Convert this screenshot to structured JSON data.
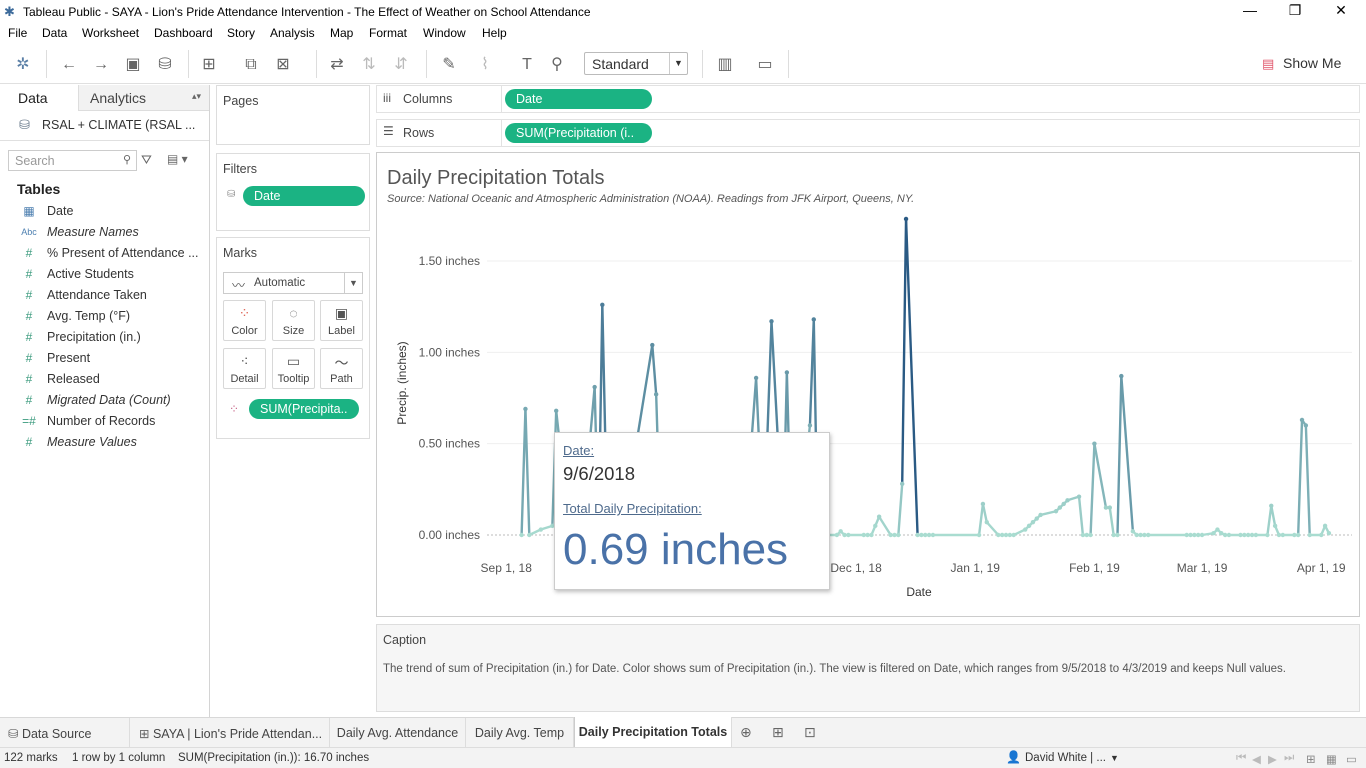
{
  "window": {
    "title": "Tableau Public - SAYA - Lion's Pride Attendance Intervention - The Effect of Weather on School Attendance",
    "minimize": "—",
    "maximize": "❐",
    "close": "✕"
  },
  "menu": [
    "File",
    "Data",
    "Worksheet",
    "Dashboard",
    "Story",
    "Analysis",
    "Map",
    "Format",
    "Window",
    "Help"
  ],
  "toolbar": {
    "fit_select": "Standard",
    "show_me": "Show Me"
  },
  "datapane": {
    "tab_data": "Data",
    "tab_analytics": "Analytics",
    "datasource": "RSAL + CLIMATE (RSAL ...",
    "search_placeholder": "Search",
    "tables_header": "Tables",
    "fields": [
      {
        "icon": "calendar-icon",
        "glyph": "▦",
        "name": "Date"
      },
      {
        "icon": "abc-icon",
        "glyph": "Abc",
        "name": "Measure Names"
      },
      {
        "icon": "hash-icon",
        "glyph": "#",
        "name": "% Present of Attendance ..."
      },
      {
        "icon": "hash-icon",
        "glyph": "#",
        "name": "Active Students"
      },
      {
        "icon": "hash-icon",
        "glyph": "#",
        "name": "Attendance Taken"
      },
      {
        "icon": "hash-icon",
        "glyph": "#",
        "name": "Avg. Temp (°F)"
      },
      {
        "icon": "hash-icon",
        "glyph": "#",
        "name": "Precipitation (in.)"
      },
      {
        "icon": "hash-icon",
        "glyph": "#",
        "name": "Present"
      },
      {
        "icon": "hash-icon",
        "glyph": "#",
        "name": "Released"
      },
      {
        "icon": "hash-icon",
        "glyph": "#",
        "name": "Migrated Data (Count)"
      },
      {
        "icon": "hash-icon",
        "glyph": "=#",
        "name": "Number of Records"
      },
      {
        "icon": "hash-icon",
        "glyph": "#",
        "name": "Measure Values"
      }
    ]
  },
  "shelves": {
    "pages_label": "Pages",
    "filters_label": "Filters",
    "filter_pill": "Date",
    "marks_label": "Marks",
    "mark_type": "Automatic",
    "mark_buttons": [
      "Color",
      "Size",
      "Label",
      "Detail",
      "Tooltip",
      "Path"
    ],
    "marks_pill": "SUM(Precipita..",
    "columns_label": "Columns",
    "columns_pill": "Date",
    "rows_label": "Rows",
    "rows_pill": "SUM(Precipitation (i.."
  },
  "view": {
    "title": "Daily Precipitation Totals",
    "subtitle": "Source: National Oceanic and Atmospheric Administration (NOAA). Readings from JFK Airport, Queens, NY."
  },
  "chart_data": {
    "type": "line",
    "title": "Daily Precipitation Totals",
    "subtitle": "Source: National Oceanic and Atmospheric Administration (NOAA). Readings from JFK Airport, Queens, NY.",
    "xlabel": "Date",
    "ylabel": "Precip. (inches)",
    "x_ticks": [
      "Sep 1, 18",
      "Oct 1, 18",
      "Nov 1, 18",
      "Dec 1, 18",
      "Jan 1, 19",
      "Feb 1, 19",
      "Mar 1, 19",
      "Apr 1, 19"
    ],
    "y_ticks": [
      "0.00 inches",
      "0.50 inches",
      "1.00 inches",
      "1.50 inches"
    ],
    "ylim": [
      0,
      1.75
    ],
    "grid": true,
    "color_encoding": "SUM(Precipitation (in.))",
    "color_range": [
      "#a9dcd0",
      "#2a5a84"
    ],
    "x": [
      "2018-09-05",
      "2018-09-06",
      "2018-09-07",
      "2018-09-10",
      "2018-09-13",
      "2018-09-14",
      "2018-09-17",
      "2018-09-18",
      "2018-09-21",
      "2018-09-24",
      "2018-09-25",
      "2018-09-26",
      "2018-09-27",
      "2018-10-01",
      "2018-10-09",
      "2018-10-10",
      "2018-10-11",
      "2018-10-12",
      "2018-10-15",
      "2018-10-26",
      "2018-10-29",
      "2018-11-01",
      "2018-11-02",
      "2018-11-05",
      "2018-11-06",
      "2018-11-07",
      "2018-11-09",
      "2018-11-12",
      "2018-11-13",
      "2018-11-14",
      "2018-11-15",
      "2018-11-16",
      "2018-11-19",
      "2018-11-20",
      "2018-11-21",
      "2018-11-26",
      "2018-11-27",
      "2018-11-28",
      "2018-11-29",
      "2018-12-03",
      "2018-12-04",
      "2018-12-05",
      "2018-12-06",
      "2018-12-07",
      "2018-12-10",
      "2018-12-11",
      "2018-12-12",
      "2018-12-13",
      "2018-12-14",
      "2018-12-17",
      "2018-12-18",
      "2018-12-19",
      "2018-12-20",
      "2018-12-21",
      "2019-01-02",
      "2019-01-03",
      "2019-01-04",
      "2019-01-07",
      "2019-01-08",
      "2019-01-09",
      "2019-01-10",
      "2019-01-11",
      "2019-01-14",
      "2019-01-15",
      "2019-01-16",
      "2019-01-17",
      "2019-01-18",
      "2019-01-22",
      "2019-01-23",
      "2019-01-24",
      "2019-01-25",
      "2019-01-28",
      "2019-01-29",
      "2019-01-30",
      "2019-01-31",
      "2019-02-01",
      "2019-02-04",
      "2019-02-05",
      "2019-02-06",
      "2019-02-07",
      "2019-02-08",
      "2019-02-11",
      "2019-02-12",
      "2019-02-13",
      "2019-02-14",
      "2019-02-15",
      "2019-02-25",
      "2019-02-26",
      "2019-02-27",
      "2019-02-28",
      "2019-03-01",
      "2019-03-04",
      "2019-03-05",
      "2019-03-06",
      "2019-03-07",
      "2019-03-08",
      "2019-03-11",
      "2019-03-12",
      "2019-03-13",
      "2019-03-14",
      "2019-03-15",
      "2019-03-18",
      "2019-03-19",
      "2019-03-20",
      "2019-03-21",
      "2019-03-22",
      "2019-03-25",
      "2019-03-26",
      "2019-03-27",
      "2019-03-28",
      "2019-03-29",
      "2019-04-01",
      "2019-04-02",
      "2019-04-03"
    ],
    "values": [
      0.0,
      0.69,
      0.0,
      0.03,
      0.05,
      0.68,
      0.1,
      0.05,
      0.1,
      0.81,
      0.0,
      1.26,
      0.3,
      0.0,
      1.04,
      0.77,
      0.1,
      0.05,
      0.0,
      0.0,
      0.0,
      0.0,
      0.0,
      0.86,
      0.4,
      0.0,
      1.17,
      0.0,
      0.89,
      0.1,
      0.0,
      0.0,
      0.6,
      1.18,
      0.0,
      0.0,
      0.02,
      0.0,
      0.0,
      0.0,
      0.0,
      0.0,
      0.05,
      0.1,
      0.0,
      0.0,
      0.0,
      0.28,
      1.73,
      0.0,
      0.0,
      0.0,
      0.0,
      0.0,
      0.0,
      0.17,
      0.07,
      0.0,
      0.0,
      0.0,
      0.0,
      0.0,
      0.03,
      0.05,
      0.07,
      0.09,
      0.11,
      0.13,
      0.15,
      0.17,
      0.19,
      0.21,
      0.0,
      0.0,
      0.0,
      0.5,
      0.15,
      0.15,
      0.0,
      0.0,
      0.87,
      0.02,
      0.0,
      0.0,
      0.0,
      0.0,
      0.0,
      0.0,
      0.0,
      0.0,
      0.0,
      0.01,
      0.03,
      0.01,
      0.0,
      0.0,
      0.0,
      0.0,
      0.0,
      0.0,
      0.0,
      0.0,
      0.16,
      0.05,
      0.0,
      0.0,
      0.0,
      0.0,
      0.63,
      0.6,
      0.0,
      0.0,
      0.05,
      0.01,
      0.0
    ],
    "hovered_point": {
      "x": "2018-09-06",
      "y": 0.69
    }
  },
  "tooltip": {
    "date_label": "Date:",
    "date_value": "9/6/2018",
    "measure_label": "Total Daily Precipitation:",
    "measure_value": "0.69 inches"
  },
  "caption": {
    "title": "Caption",
    "text": "The trend of sum of Precipitation (in.) for Date.  Color shows sum of Precipitation (in.). The view is filtered on Date, which ranges from 9/5/2018 to 4/3/2019 and keeps Null values."
  },
  "sheet_tabs": [
    {
      "label": "Data Source",
      "icon": "database-icon",
      "active": false
    },
    {
      "label": "SAYA | Lion's Pride Attendan...",
      "icon": "dashboard-icon",
      "active": false
    },
    {
      "label": "Daily Avg. Attendance",
      "icon": "",
      "active": false
    },
    {
      "label": "Daily Avg. Temp",
      "icon": "",
      "active": false
    },
    {
      "label": "Daily Precipitation Totals",
      "icon": "",
      "active": true
    }
  ],
  "status": {
    "marks": "122 marks",
    "rows": "1 row by 1 column",
    "sum": "SUM(Precipitation (in.)): 16.70 inches",
    "user": "David White | ..."
  }
}
